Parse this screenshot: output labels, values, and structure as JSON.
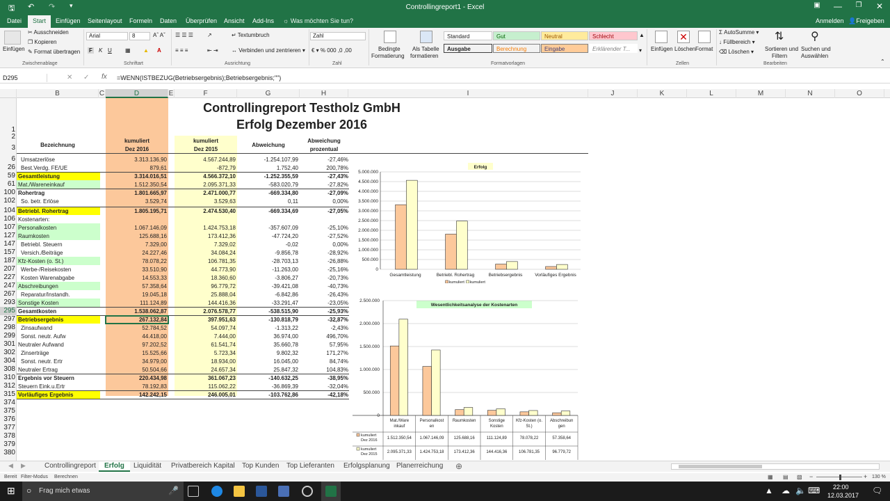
{
  "window": {
    "title": "Controllingreport1 - Excel"
  },
  "ribbon_tabs": [
    "Datei",
    "Start",
    "Einfügen",
    "Seitenlayout",
    "Formeln",
    "Daten",
    "Überprüfen",
    "Ansicht",
    "Add-Ins"
  ],
  "tell_me": "Was möchten Sie tun?",
  "account": {
    "signin": "Anmelden",
    "share": "Freigeben"
  },
  "ribbon": {
    "paste": "Einfügen",
    "cut": "Ausschneiden",
    "copy": "Kopieren",
    "format_painter": "Format übertragen",
    "clipboard": "Zwischenablage",
    "font_name": "Arial",
    "font_size": "8",
    "font_group": "Schriftart",
    "wrap": "Textumbruch",
    "merge": "Verbinden und zentrieren",
    "alignment": "Ausrichtung",
    "number_format": "Zahl",
    "number_group": "Zahl",
    "cond_format_1": "Bedingte",
    "cond_format_2": "Formatierung",
    "as_table_1": "Als Tabelle",
    "as_table_2": "formatieren",
    "styles": [
      "Standard",
      "Gut",
      "Neutral",
      "Schlecht",
      "Ausgabe",
      "Berechnung",
      "Eingabe",
      "Erklärender T..."
    ],
    "styles_group": "Formatvorlagen",
    "insert": "Einfügen",
    "delete": "Löschen",
    "format": "Format",
    "cells_group": "Zellen",
    "autosum": "AutoSumme",
    "fill": "Füllbereich",
    "clear": "Löschen",
    "sort_1": "Sortieren und",
    "sort_2": "Filtern",
    "find_1": "Suchen und",
    "find_2": "Auswählen",
    "editing_group": "Bearbeiten"
  },
  "formula_bar": {
    "name_box": "D295",
    "formula": "=WENN(ISTBEZUG(Betriebsergebnis);Betriebsergebnis;\"\")"
  },
  "columns": [
    "B",
    "C",
    "D",
    "E",
    "F",
    "G",
    "H",
    "I",
    "J",
    "K",
    "L",
    "M",
    "N",
    "O"
  ],
  "row_numbers": [
    "1",
    "2",
    "3",
    "6",
    "26",
    "59",
    "61",
    "100",
    "102",
    "104",
    "106",
    "107",
    "127",
    "147",
    "157",
    "187",
    "207",
    "227",
    "247",
    "267",
    "293",
    "295",
    "297",
    "298",
    "299",
    "301",
    "302",
    "304",
    "308",
    "310",
    "312",
    "315",
    "374",
    "375",
    "376",
    "377",
    "378",
    "379",
    "380"
  ],
  "report": {
    "title1": "Controllingreport Testholz GmbH",
    "title2": "Erfolg Dezember 2016",
    "hdr_bez": "Bezeichnung",
    "hdr_d1": "kumuliert",
    "hdr_d2": "Dez 2016",
    "hdr_f1": "kumuliert",
    "hdr_f2": "Dez 2015",
    "hdr_g": "Abweichung",
    "hdr_h1": "Abweichung",
    "hdr_h2": "prozentual",
    "rows": [
      {
        "label": "Umsatzerlöse",
        "d": "3.313.136,90",
        "f": "4.567.244,89",
        "g": "-1.254.107,99",
        "h": "-27,46%",
        "style": ""
      },
      {
        "label": "Best.Verdg. FE/UE",
        "d": "879,61",
        "f": "-872,79",
        "g": "1.752,40",
        "h": "200,78%",
        "style": ""
      },
      {
        "label": "Gesamtleistung",
        "d": "3.314.016,51",
        "f": "4.566.372,10",
        "g": "-1.252.355,59",
        "h": "-27,43%",
        "style": "total-ylw"
      },
      {
        "label": "Mat./Wareneinkauf",
        "d": "1.512.350,54",
        "f": "2.095.371,33",
        "g": "-583.020,79",
        "h": "-27,82%",
        "style": "grn"
      },
      {
        "label": "Rohertrag",
        "d": "1.801.665,97",
        "f": "2.471.000,77",
        "g": "-669.334,80",
        "h": "-27,09%",
        "style": "bold"
      },
      {
        "label": "So. betr. Erlöse",
        "d": "3.529,74",
        "f": "3.529,63",
        "g": "0,11",
        "h": "0,00%",
        "style": ""
      },
      {
        "label": "Betriebl. Rohertrag",
        "d": "1.805.195,71",
        "f": "2.474.530,40",
        "g": "-669.334,69",
        "h": "-27,05%",
        "style": "total-ylw"
      },
      {
        "label": "Kostenarten:",
        "d": "",
        "f": "",
        "g": "",
        "h": "",
        "style": ""
      },
      {
        "label": "Personalkosten",
        "d": "1.067.146,09",
        "f": "1.424.753,18",
        "g": "-357.607,09",
        "h": "-25,10%",
        "style": "grn"
      },
      {
        "label": "Raumkosten",
        "d": "125.688,16",
        "f": "173.412,36",
        "g": "-47.724,20",
        "h": "-27,52%",
        "style": "grn"
      },
      {
        "label": "Betriebl. Steuern",
        "d": "7.329,00",
        "f": "7.329,02",
        "g": "-0,02",
        "h": "0,00%",
        "style": ""
      },
      {
        "label": "Versich./Beiträge",
        "d": "24.227,46",
        "f": "34.084,24",
        "g": "-9.856,78",
        "h": "-28,92%",
        "style": ""
      },
      {
        "label": "Kfz-Kosten (o. St.)",
        "d": "78.078,22",
        "f": "106.781,35",
        "g": "-28.703,13",
        "h": "-26,88%",
        "style": "grn"
      },
      {
        "label": "Werbe-/Reisekosten",
        "d": "33.510,90",
        "f": "44.773,90",
        "g": "-11.263,00",
        "h": "-25,16%",
        "style": ""
      },
      {
        "label": "Kosten Warenabgabe",
        "d": "14.553,33",
        "f": "18.360,60",
        "g": "-3.806,27",
        "h": "-20,73%",
        "style": ""
      },
      {
        "label": "Abschreibungen",
        "d": "57.358,64",
        "f": "96.779,72",
        "g": "-39.421,08",
        "h": "-40,73%",
        "style": "grn"
      },
      {
        "label": "Reparatur/Instandh.",
        "d": "19.045,18",
        "f": "25.888,04",
        "g": "-6.842,86",
        "h": "-26,43%",
        "style": ""
      },
      {
        "label": "Sonstige Kosten",
        "d": "111.124,89",
        "f": "144.416,36",
        "g": "-33.291,47",
        "h": "-23,05%",
        "style": "grn"
      },
      {
        "label": "Gesamtkosten",
        "d": "1.538.062,87",
        "f": "2.076.578,77",
        "g": "-538.515,90",
        "h": "-25,93%",
        "style": "bold"
      },
      {
        "label": "Betriebsergebnis",
        "d": "267.132,84",
        "f": "397.951,63",
        "g": "-130.818,79",
        "h": "-32,87%",
        "style": "total-ylw"
      },
      {
        "label": "Zinsaufwand",
        "d": "52.784,52",
        "f": "54.097,74",
        "g": "-1.313,22",
        "h": "-2,43%",
        "style": ""
      },
      {
        "label": "Sonst. neutr. Aufw",
        "d": "44.418,00",
        "f": "7.444,00",
        "g": "36.974,00",
        "h": "496,70%",
        "style": ""
      },
      {
        "label": "Neutraler Aufwand",
        "d": "97.202,52",
        "f": "61.541,74",
        "g": "35.660,78",
        "h": "57,95%",
        "style": ""
      },
      {
        "label": "Zinserträge",
        "d": "15.525,66",
        "f": "5.723,34",
        "g": "9.802,32",
        "h": "171,27%",
        "style": ""
      },
      {
        "label": "Sonst. neutr. Ertr",
        "d": "34.979,00",
        "f": "18.934,00",
        "g": "16.045,00",
        "h": "84,74%",
        "style": ""
      },
      {
        "label": "Neutraler Ertrag",
        "d": "50.504,66",
        "f": "24.657,34",
        "g": "25.847,32",
        "h": "104,83%",
        "style": ""
      },
      {
        "label": "Ergebnis vor Steuern",
        "d": "220.434,98",
        "f": "361.067,23",
        "g": "-140.632,25",
        "h": "-38,95%",
        "style": "bold"
      },
      {
        "label": "Steuern Eink.u.Ertr",
        "d": "78.192,83",
        "f": "115.062,22",
        "g": "-36.869,39",
        "h": "-32,04%",
        "style": ""
      },
      {
        "label": "Vorläufiges Ergebnis",
        "d": "142.242,15",
        "f": "246.005,01",
        "g": "-103.762,86",
        "h": "-42,18%",
        "style": "total-ylw"
      }
    ]
  },
  "chart_data": [
    {
      "type": "bar",
      "title": "Erfolg",
      "categories": [
        "Gesamtleistung",
        "Betriebl. Rohertrag",
        "Betriebsergebnis",
        "Vorläufiges Ergebnis"
      ],
      "series": [
        {
          "name": "kumuliert Dez 2016",
          "values": [
            3314016.51,
            1805195.71,
            267132.84,
            142242.15
          ]
        },
        {
          "name": "kumuliert Dez 2015",
          "values": [
            4566372.1,
            2474530.4,
            397951.63,
            246005.01
          ]
        }
      ],
      "ylim": [
        0,
        5000000
      ],
      "ticks": [
        "5.000.000",
        "4.500.000",
        "4.000.000",
        "3.500.000",
        "3.000.000",
        "2.500.000",
        "2.000.000",
        "1.500.000",
        "1.000.000",
        "500.000",
        "0"
      ],
      "legend": [
        "kumuliert Dez 2016",
        "kumuliert Dez 2015"
      ],
      "colors": [
        "#fcc89b",
        "#ffffcc"
      ]
    },
    {
      "type": "bar",
      "title": "Wesentlichkeitsanalyse der Kostenarten",
      "categories": [
        "Mat./Wareneinkauf",
        "Personalkosten",
        "Raumkosten",
        "Sonstige Kosten",
        "Kfz-Kosten (o. St.)",
        "Abschreibungen"
      ],
      "category_labels": [
        "Mat./Ware inkauf",
        "Personalkost en",
        "Raumkosten",
        "Sonstige Kosten",
        "Kfz-Kosten (o. St.)",
        "Abschreibun gen"
      ],
      "series": [
        {
          "name": "kumuliert Dez 2016",
          "values": [
            1512350.54,
            1067146.09,
            125688.16,
            111124.89,
            78078.22,
            57358.64
          ],
          "labels": [
            "1.512.350,54",
            "1.067.146,09",
            "125.688,16",
            "111.124,89",
            "78.078,22",
            "57.358,64"
          ]
        },
        {
          "name": "kumuliert Dez 2015",
          "values": [
            2095371.33,
            1424753.18,
            173412.36,
            144416.36,
            106781.35,
            96779.72
          ],
          "labels": [
            "2.095.371,33",
            "1.424.753,18",
            "173.412,36",
            "144.416,36",
            "106.781,35",
            "96.779,72"
          ]
        }
      ],
      "ylim": [
        0,
        2500000
      ],
      "ticks": [
        "2.500.000",
        "2.000.000",
        "1.500.000",
        "1.000.000",
        "500.000",
        "0"
      ],
      "colors": [
        "#fcc89b",
        "#ffffcc"
      ]
    }
  ],
  "sheet_tabs": [
    "Controllingreport",
    "Erfolg",
    "Liquidität",
    "Privatbereich Kapital",
    "Top Kunden",
    "Top Lieferanten",
    "Erfolgsplanung",
    "Planerreichung"
  ],
  "active_sheet": "Erfolg",
  "status": {
    "ready": "Bereit",
    "filter": "Filter-Modus",
    "calc": "Berechnen",
    "zoom": "130 %"
  },
  "taskbar": {
    "search": "Frag mich etwas",
    "time": "22:00",
    "date": "12.03.2017"
  }
}
